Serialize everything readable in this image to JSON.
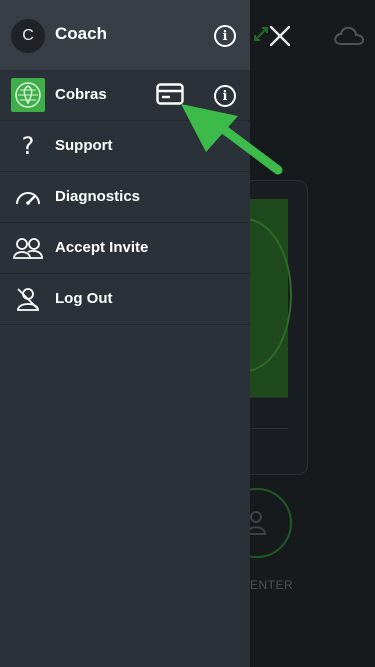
{
  "header": {
    "avatar_initial": "C",
    "title": "Coach"
  },
  "team": {
    "name": "Cobras"
  },
  "menu": {
    "items": [
      {
        "label": "Support",
        "icon": "question-icon"
      },
      {
        "label": "Diagnostics",
        "icon": "gauge-icon"
      },
      {
        "label": "Accept Invite",
        "icon": "people-icon"
      },
      {
        "label": "Log Out",
        "icon": "logout-icon"
      }
    ]
  },
  "background": {
    "center_label": "ENTER"
  },
  "colors": {
    "drawer": "#2b3138",
    "header": "#383e45",
    "accent_green": "#3fae4a",
    "arrow_green": "#3dbb4a"
  }
}
